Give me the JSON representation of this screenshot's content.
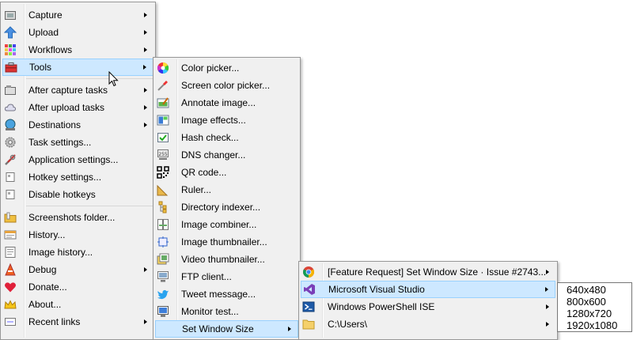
{
  "main_menu": [
    {
      "label": "Capture",
      "icon": "capture-icon",
      "submenu": true
    },
    {
      "label": "Upload",
      "icon": "upload-arrow-icon",
      "submenu": true
    },
    {
      "label": "Workflows",
      "icon": "workflows-grid-icon",
      "submenu": true
    },
    {
      "label": "Tools",
      "icon": "toolbox-icon",
      "submenu": true,
      "highlighted": true
    },
    {
      "separator": true
    },
    {
      "label": "After capture tasks",
      "icon": "after-capture-icon",
      "submenu": true
    },
    {
      "label": "After upload tasks",
      "icon": "after-upload-cloud-icon",
      "submenu": true
    },
    {
      "label": "Destinations",
      "icon": "destinations-globe-icon",
      "submenu": true
    },
    {
      "label": "Task settings...",
      "icon": "task-settings-gear-icon"
    },
    {
      "label": "Application settings...",
      "icon": "application-settings-wrench-icon"
    },
    {
      "label": "Hotkey settings...",
      "icon": "hotkey-keyboard-icon"
    },
    {
      "label": "Disable hotkeys",
      "icon": "disable-hotkeys-keyboard-icon"
    },
    {
      "separator": true
    },
    {
      "label": "Screenshots folder...",
      "icon": "screenshots-folder-icon"
    },
    {
      "label": "History...",
      "icon": "history-icon"
    },
    {
      "label": "Image history...",
      "icon": "image-history-icon"
    },
    {
      "label": "Debug",
      "icon": "debug-cone-icon",
      "submenu": true
    },
    {
      "label": "Donate...",
      "icon": "donate-heart-icon"
    },
    {
      "label": "About...",
      "icon": "about-crown-icon"
    },
    {
      "label": "Recent links",
      "icon": "recent-links-icon",
      "submenu": true
    }
  ],
  "tools_menu": [
    {
      "label": "Color picker...",
      "icon": "color-picker-wheel-icon"
    },
    {
      "label": "Screen color picker...",
      "icon": "screen-color-picker-pipette-icon"
    },
    {
      "label": "Annotate image...",
      "icon": "annotate-image-icon"
    },
    {
      "label": "Image effects...",
      "icon": "image-effects-icon"
    },
    {
      "label": "Hash check...",
      "icon": "hash-check-icon"
    },
    {
      "label": "DNS changer...",
      "icon": "dns-changer-icon"
    },
    {
      "label": "QR code...",
      "icon": "qr-code-icon"
    },
    {
      "label": "Ruler...",
      "icon": "ruler-icon"
    },
    {
      "label": "Directory indexer...",
      "icon": "directory-indexer-icon"
    },
    {
      "label": "Image combiner...",
      "icon": "image-combiner-icon"
    },
    {
      "label": "Image thumbnailer...",
      "icon": "image-thumbnailer-icon"
    },
    {
      "label": "Video thumbnailer...",
      "icon": "video-thumbnailer-icon"
    },
    {
      "label": "FTP client...",
      "icon": "ftp-client-icon"
    },
    {
      "label": "Tweet message...",
      "icon": "twitter-bird-icon"
    },
    {
      "label": "Monitor test...",
      "icon": "monitor-test-icon"
    },
    {
      "label": "Set Window Size",
      "submenu": true,
      "highlighted": true
    }
  ],
  "window_menu": [
    {
      "label": "[Feature Request] Set Window Size · Issue #2743...",
      "icon": "chrome-icon",
      "submenu": true
    },
    {
      "label": "Microsoft Visual Studio",
      "icon": "visual-studio-icon",
      "submenu": true,
      "highlighted": true
    },
    {
      "label": "Windows PowerShell ISE",
      "icon": "powershell-icon",
      "submenu": true
    },
    {
      "label": "C:\\Users\\",
      "icon": "folder-icon",
      "submenu": true
    }
  ],
  "sizes_menu": [
    "640x480",
    "800x600",
    "1280x720",
    "1920x1080"
  ],
  "colors": {
    "menu_bg": "#f0f0f0",
    "highlight_bg": "#cde8ff",
    "highlight_border": "#99d1ff"
  }
}
